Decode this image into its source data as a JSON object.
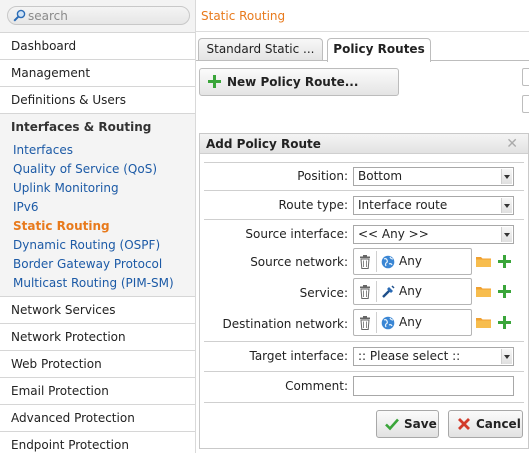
{
  "search": {
    "placeholder": "search"
  },
  "sidebar": {
    "items_top": [
      {
        "label": "Dashboard"
      },
      {
        "label": "Management"
      },
      {
        "label": "Definitions & Users"
      }
    ],
    "active_section": {
      "label": "Interfaces & Routing"
    },
    "subitems": [
      {
        "label": "Interfaces"
      },
      {
        "label": "Quality of Service (QoS)"
      },
      {
        "label": "Uplink Monitoring"
      },
      {
        "label": "IPv6"
      },
      {
        "label": "Static Routing"
      },
      {
        "label": "Dynamic Routing (OSPF)"
      },
      {
        "label": "Border Gateway Protocol"
      },
      {
        "label": "Multicast Routing (PIM-SM)"
      }
    ],
    "items_bottom": [
      {
        "label": "Network Services"
      },
      {
        "label": "Network Protection"
      },
      {
        "label": "Web Protection"
      },
      {
        "label": "Email Protection"
      },
      {
        "label": "Advanced Protection"
      },
      {
        "label": "Endpoint Protection"
      }
    ]
  },
  "page": {
    "title": "Static Routing"
  },
  "tabs": [
    {
      "label": "Standard Static ..."
    },
    {
      "label": "Policy Routes"
    }
  ],
  "toolbar": {
    "new_label": "New Policy Route..."
  },
  "dialog": {
    "title": "Add Policy Route",
    "close": "✕",
    "position": {
      "label": "Position:",
      "value": "Bottom"
    },
    "route_type": {
      "label": "Route type:",
      "value": "Interface route"
    },
    "source_interface": {
      "label": "Source interface:",
      "value": "<< Any >>"
    },
    "source_network": {
      "label": "Source network:",
      "value": "Any"
    },
    "service": {
      "label": "Service:",
      "value": "Any"
    },
    "destination_network": {
      "label": "Destination network:",
      "value": "Any"
    },
    "target_interface": {
      "label": "Target interface:",
      "value": ":: Please select ::"
    },
    "comment": {
      "label": "Comment:",
      "value": ""
    },
    "save_label": "Save",
    "cancel_label": "Cancel"
  },
  "colors": {
    "accent": "#e87a1c",
    "link": "#1c5aa6",
    "add_green": "#3aa53a",
    "cancel_red": "#d23a2a",
    "folder_orange": "#f0a030"
  }
}
